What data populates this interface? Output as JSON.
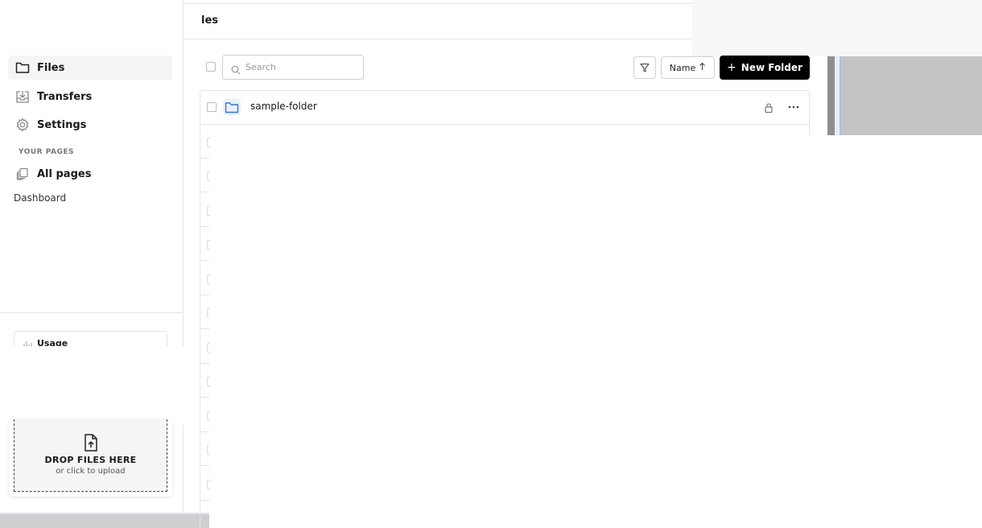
{
  "sidebar": {
    "nav": [
      {
        "label": "Files",
        "icon": "folder-icon",
        "active": true
      },
      {
        "label": "Transfers",
        "icon": "transfer-icon",
        "active": false
      },
      {
        "label": "Settings",
        "icon": "gear-icon",
        "active": false
      }
    ],
    "section_label": "YOUR PAGES",
    "all_pages_label": "All pages",
    "dashboard_label": "Dashboard",
    "usage_title": "Usage",
    "drop_title": "DROP FILES HERE",
    "drop_subtitle": "or click to upload"
  },
  "header": {
    "title": "les"
  },
  "toolbar": {
    "search_placeholder": "Search",
    "sort_label": "Name",
    "sort_direction_icon": "arrow-up-icon",
    "new_folder_label": "New Folder"
  },
  "files": [
    {
      "name": "sample-folder",
      "type": "folder",
      "locked": true
    }
  ],
  "colors": {
    "accent": "#000000",
    "folder": "#3b73d6",
    "active_bg": "#f5f5f5"
  }
}
